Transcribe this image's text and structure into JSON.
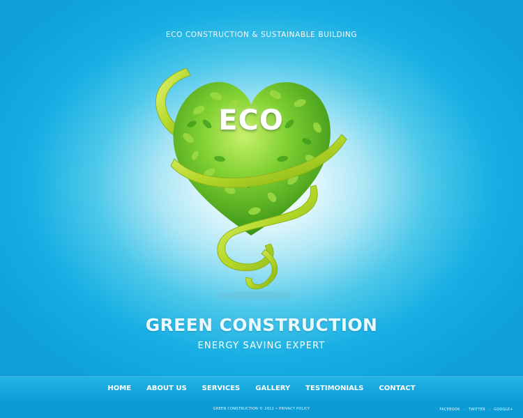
{
  "header": {
    "tagline": "ECO CONSTRUCTION & SUSTAINABLE BUILDING"
  },
  "hero": {
    "badge_text": "ECO",
    "title": "GREEN CONSTRUCTION",
    "subtitle": "ENERGY SAVING EXPERT"
  },
  "nav": {
    "items": [
      {
        "label": "HOME"
      },
      {
        "label": "ABOUT US"
      },
      {
        "label": "SERVICES"
      },
      {
        "label": "GALLERY"
      },
      {
        "label": "TESTIMONIALS"
      },
      {
        "label": "CONTACT"
      }
    ]
  },
  "footer": {
    "copyright": "GREEN CONSTRUCTION © 2012 • PRIVACY POLICY",
    "social": {
      "facebook": "FACEBOOK",
      "twitter": "TWITTER",
      "google": "GOOGLE+",
      "separator": "-"
    }
  },
  "colors": {
    "background_accent": "#16aee3",
    "leaf_green": "#5fbe26",
    "ribbon_green": "#b9dc2c",
    "nav_background": "#0ea0d8"
  }
}
